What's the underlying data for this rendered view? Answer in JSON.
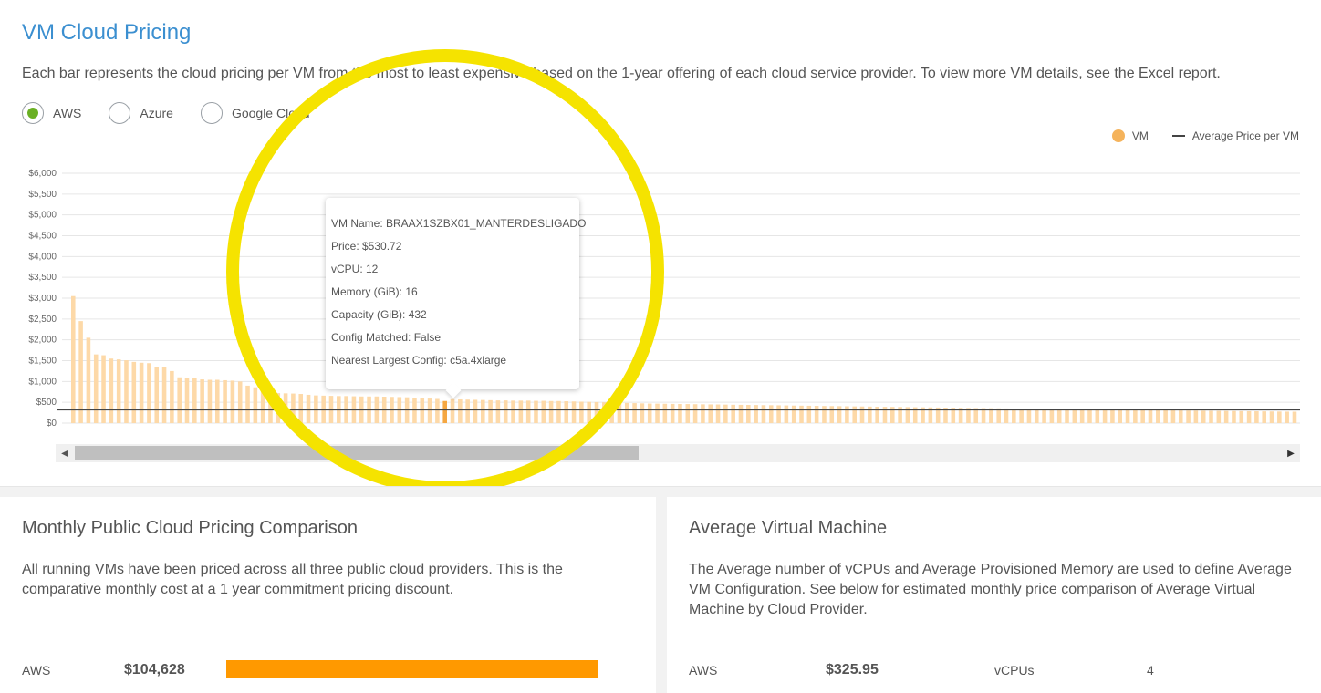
{
  "header": {
    "title": "VM Cloud Pricing",
    "description": "Each bar represents the cloud pricing per VM from the most to least expensive based on the 1-year offering of each cloud service provider. To view more VM details, see the Excel report."
  },
  "providers": [
    {
      "label": "AWS",
      "selected": true
    },
    {
      "label": "Azure",
      "selected": false
    },
    {
      "label": "Google Cloud",
      "selected": false
    }
  ],
  "colors": {
    "accent_title": "#3b8fd0",
    "bar": "#fdd9a8",
    "bar_highlight": "#f5a742",
    "legend_vm": "#f5b35b",
    "average_line": "#444444",
    "radio_selected": "#6ab023",
    "aws_bar": "#ff9900",
    "highlight_ring": "#f5e300"
  },
  "legend": {
    "vm": "VM",
    "average": "Average Price per VM"
  },
  "chart_data": {
    "type": "bar",
    "ylim": [
      0,
      6000
    ],
    "y_ticks": [
      "$6,000",
      "$5,500",
      "$5,000",
      "$4,500",
      "$4,000",
      "$3,500",
      "$3,000",
      "$2,500",
      "$2,000",
      "$1,500",
      "$1,000",
      "$500",
      "$0"
    ],
    "y_tick_values": [
      6000,
      5500,
      5000,
      4500,
      4000,
      3500,
      3000,
      2500,
      2000,
      1500,
      1000,
      500,
      0
    ],
    "average": 325.95,
    "highlight_index": 49,
    "values": [
      3050,
      2450,
      2050,
      1650,
      1630,
      1550,
      1530,
      1510,
      1470,
      1450,
      1440,
      1350,
      1340,
      1250,
      1100,
      1090,
      1080,
      1050,
      1040,
      1040,
      1030,
      1020,
      1000,
      900,
      860,
      780,
      730,
      720,
      715,
      710,
      700,
      680,
      665,
      660,
      655,
      650,
      650,
      645,
      640,
      640,
      640,
      635,
      630,
      625,
      620,
      610,
      600,
      590,
      580,
      530.72,
      575,
      570,
      565,
      560,
      555,
      550,
      545,
      545,
      540,
      540,
      540,
      535,
      535,
      530,
      530,
      525,
      520,
      515,
      510,
      505,
      500,
      495,
      490,
      485,
      480,
      475,
      470,
      468,
      465,
      462,
      460,
      458,
      455,
      452,
      450,
      448,
      445,
      442,
      440,
      438,
      435,
      432,
      430,
      428,
      425,
      422,
      420,
      418,
      415,
      412,
      410,
      408,
      405,
      402,
      400,
      398,
      395,
      392,
      390,
      388,
      385,
      382,
      380,
      378,
      375,
      372,
      370,
      368,
      365,
      362,
      360,
      358,
      355,
      352,
      350,
      348,
      345,
      342,
      340,
      338,
      336,
      334,
      332,
      330,
      328,
      326,
      324,
      322,
      320,
      318,
      316,
      314,
      312,
      310,
      308,
      306,
      304,
      302,
      300,
      298,
      296,
      294,
      292,
      290,
      288,
      286,
      284,
      282,
      280,
      278,
      276,
      274
    ]
  },
  "tooltip": {
    "lines": [
      "VM Name: BRAAX1SZBX01_MANTERDESLIGADO",
      "Price: $530.72",
      "vCPU: 12",
      "Memory (GiB): 16",
      "Capacity (GiB): 432",
      "Config Matched: False",
      "Nearest Largest Config: c5a.4xlarge"
    ]
  },
  "scrollbar": {
    "left_arrow": "◀",
    "right_arrow": "▶"
  },
  "monthly": {
    "title": "Monthly Public Cloud Pricing Comparison",
    "description": "All running VMs have been priced across all three public cloud providers. This is the comparative monthly cost at a 1 year commitment pricing discount.",
    "rows": [
      {
        "provider": "AWS",
        "value": "$104,628",
        "fraction": 1.0
      }
    ]
  },
  "average_vm": {
    "title": "Average Virtual Machine",
    "description": "The Average number of vCPUs and Average Provisioned Memory are used to define Average VM Configuration. See below for estimated monthly price comparison of Average Virtual Machine by Cloud Provider.",
    "rows": [
      {
        "provider": "AWS",
        "value": "$325.95",
        "metric_label": "vCPUs",
        "metric_value": "4"
      }
    ]
  }
}
